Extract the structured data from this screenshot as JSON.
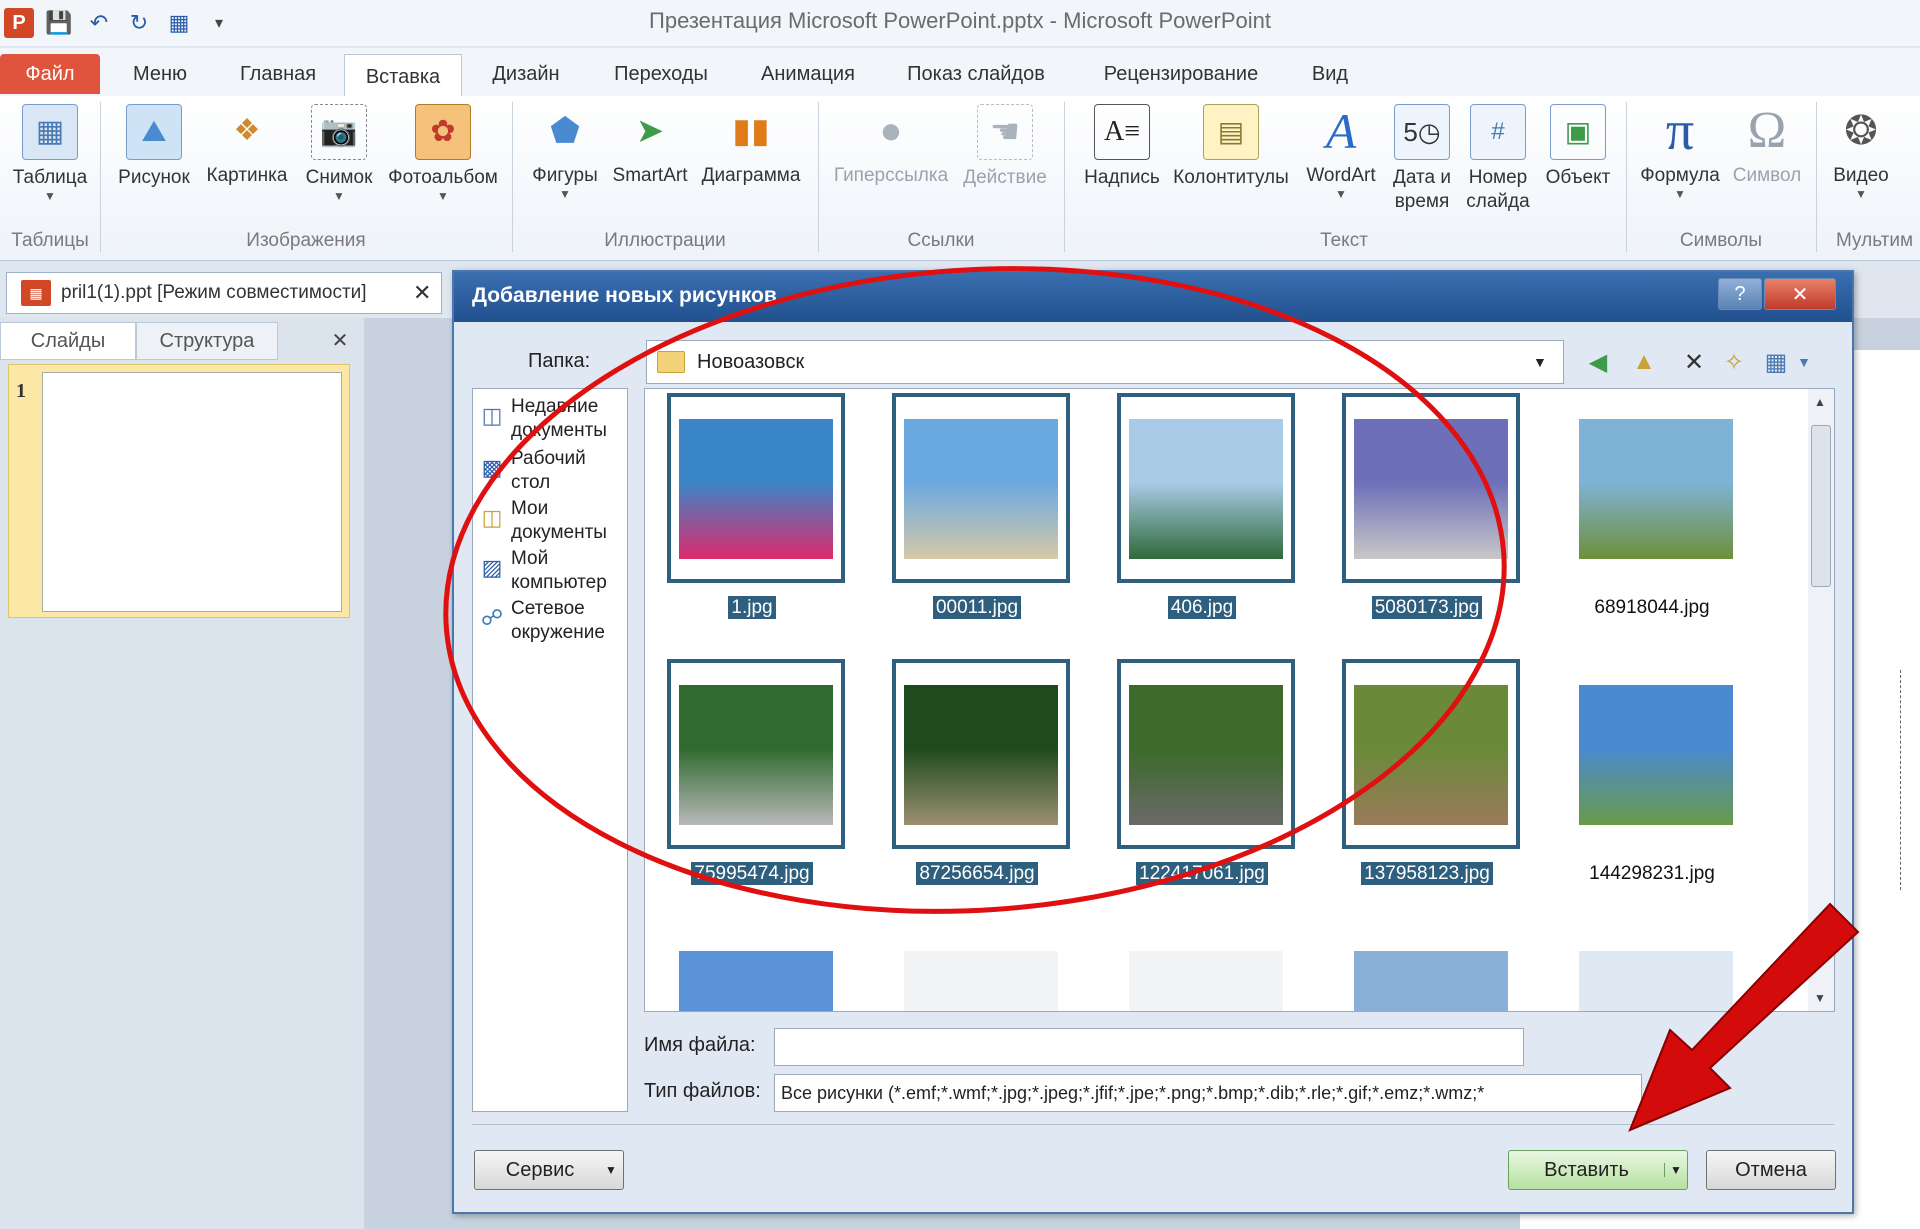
{
  "window": {
    "title": "Презентация Microsoft PowerPoint.pptx - Microsoft PowerPoint",
    "app_icon_letter": "P"
  },
  "ribbon_tabs": [
    "Файл",
    "Меню",
    "Главная",
    "Вставка",
    "Дизайн",
    "Переходы",
    "Анимация",
    "Показ слайдов",
    "Рецензирование",
    "Вид"
  ],
  "ribbon": {
    "buttons": {
      "table": "Таблица",
      "picture": "Рисунок",
      "clipart": "Картинка",
      "screenshot": "Снимок",
      "album": "Фотоальбом",
      "shapes": "Фигуры",
      "smartart": "SmartArt",
      "chart": "Диаграмма",
      "hyperlink": "Гиперссылка",
      "action": "Действие",
      "textbox": "Надпись",
      "headerfooter": "Колонтитулы",
      "wordart": "WordArt",
      "datetime_1": "Дата и",
      "datetime_2": "время",
      "slidenum_1": "Номер",
      "slidenum_2": "слайда",
      "object": "Объект",
      "equation": "Формула",
      "symbol": "Символ",
      "video": "Видео"
    },
    "groups": {
      "tables": "Таблицы",
      "images": "Изображения",
      "illustrations": "Иллюстрации",
      "links": "Ссылки",
      "text": "Текст",
      "symbols": "Символы",
      "media": "Мультим"
    }
  },
  "doc_tab": {
    "label": "pril1(1).ppt [Режим совместимости]",
    "close": "✕"
  },
  "left_pane": {
    "tabs": [
      "Слайды",
      "Структура"
    ],
    "close": "✕",
    "slide_number": "1"
  },
  "dialog": {
    "title": "Добавление новых рисунков",
    "help": "?",
    "close": "✕",
    "lookin_label": "Папка:",
    "lookin_value": "Новоазовск",
    "places": [
      {
        "label1": "Недавние",
        "label2": "документы",
        "icon": "recent-docs-icon"
      },
      {
        "label1": "Рабочий",
        "label2": "стол",
        "icon": "desktop-icon"
      },
      {
        "label1": "Мои",
        "label2": "документы",
        "icon": "my-documents-icon"
      },
      {
        "label1": "Мой",
        "label2": "компьютер",
        "icon": "my-computer-icon"
      },
      {
        "label1": "Сетевое",
        "label2": "окружение",
        "icon": "network-icon"
      }
    ],
    "files": [
      {
        "name": "1.jpg",
        "selected": true,
        "colors": [
          "#3a86c8",
          "#dd2a6c"
        ]
      },
      {
        "name": "00011.jpg",
        "selected": true,
        "colors": [
          "#6aa8e0",
          "#d6c9a8"
        ]
      },
      {
        "name": "406.jpg",
        "selected": true,
        "colors": [
          "#a9cbe8",
          "#2f6a3a"
        ]
      },
      {
        "name": "5080173.jpg",
        "selected": true,
        "colors": [
          "#6d6fb8",
          "#c8c8c8"
        ]
      },
      {
        "name": "68918044.jpg",
        "selected": false,
        "colors": [
          "#7fb3d6",
          "#6e8f3a"
        ]
      },
      {
        "name": "75995474.jpg",
        "selected": true,
        "colors": [
          "#2f6a2f",
          "#b8b8b8"
        ]
      },
      {
        "name": "87256654.jpg",
        "selected": true,
        "colors": [
          "#1e4a1e",
          "#9c9070"
        ]
      },
      {
        "name": "122417061.jpg",
        "selected": true,
        "colors": [
          "#3c6a2a",
          "#6a6a6a"
        ]
      },
      {
        "name": "137958123.jpg",
        "selected": true,
        "colors": [
          "#6a8a3a",
          "#9a7a5a"
        ]
      },
      {
        "name": "144298231.jpg",
        "selected": false,
        "colors": [
          "#4a8ad0",
          "#6a9a4a"
        ]
      },
      {
        "name": "",
        "selected": false,
        "colors": [
          "#5b93d8",
          "#8ab6e8"
        ]
      },
      {
        "name": "",
        "selected": false,
        "colors": [
          "#f2f4f6",
          "#2e5a2e"
        ]
      },
      {
        "name": "",
        "selected": false,
        "colors": [
          "#f2f4f6",
          "#8a6a3a"
        ]
      },
      {
        "name": "",
        "selected": false,
        "colors": [
          "#8ab0d8",
          "#2f5a8a"
        ]
      },
      {
        "name": "",
        "selected": false,
        "colors": [
          "#dfe9f3",
          "#2a4a2a"
        ]
      }
    ],
    "filename_label": "Имя файла:",
    "filename_value": "",
    "filetype_label": "Тип файлов:",
    "filetype_value": "Все рисунки (*.emf;*.wmf;*.jpg;*.jpeg;*.jfif;*.jpe;*.png;*.bmp;*.dib;*.rle;*.gif;*.emz;*.wmz;*",
    "tools_button": "Сервис",
    "insert_button": "Вставить",
    "cancel_button": "Отмена"
  },
  "annotation_colors": {
    "ellipse": "#e01010",
    "arrow": "#d40b0b"
  }
}
